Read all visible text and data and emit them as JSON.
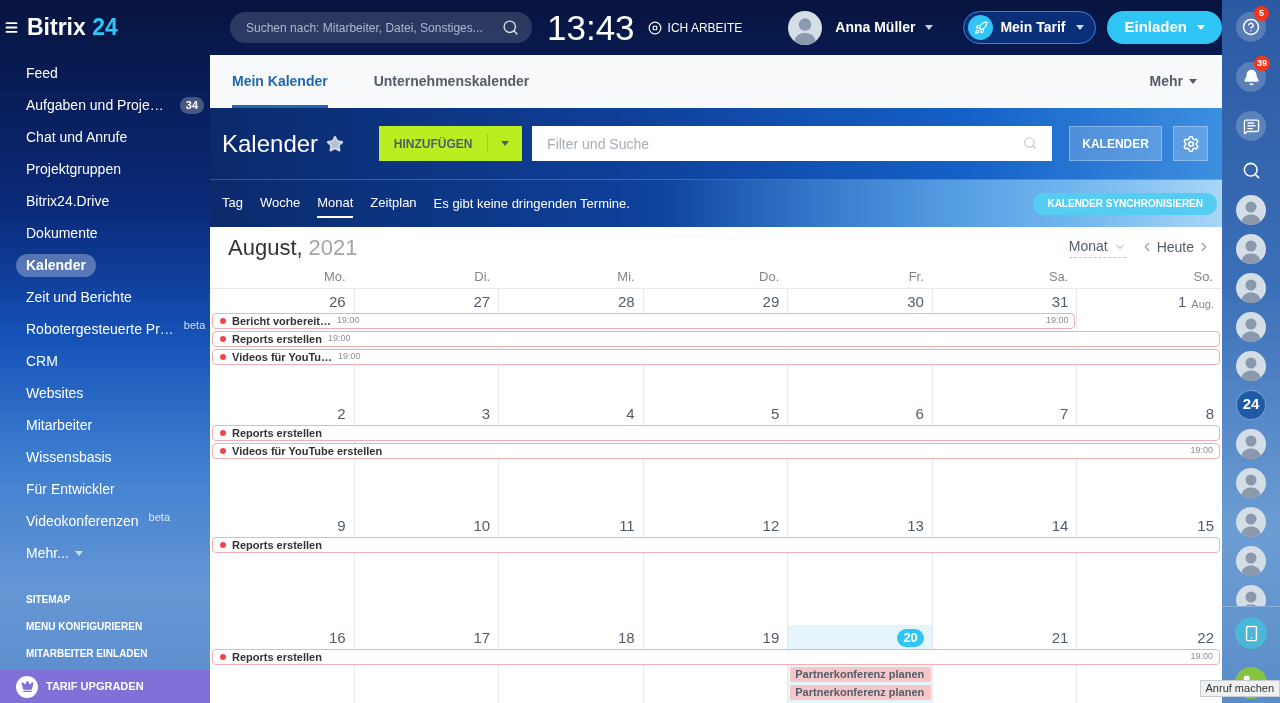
{
  "header": {
    "logo": {
      "text": "Bitrix",
      "accent": "24"
    },
    "search": {
      "placeholder": "Suchen nach: Mitarbeiter, Datei, Sonstiges..."
    },
    "clock": "13:43",
    "work_status": "ICH ARBEITE",
    "user_name": "Anna Müller",
    "tariff_button": "Mein Tarif",
    "invite_button": "Einladen"
  },
  "sidebar": {
    "items": [
      {
        "label": "Feed",
        "selected": false
      },
      {
        "label": "Aufgaben und Proje…",
        "selected": false,
        "counter": "34"
      },
      {
        "label": "Chat und Anrufe",
        "selected": false
      },
      {
        "label": "Projektgruppen",
        "selected": false
      },
      {
        "label": "Bitrix24.Drive",
        "selected": false
      },
      {
        "label": "Dokumente",
        "selected": false
      },
      {
        "label": "Kalender",
        "selected": true
      },
      {
        "label": "Zeit und Berichte",
        "selected": false
      },
      {
        "label": "Robotergesteuerte Pr…",
        "selected": false,
        "tag": "beta"
      },
      {
        "label": "CRM",
        "selected": false
      },
      {
        "label": "Websites",
        "selected": false
      },
      {
        "label": "Mitarbeiter",
        "selected": false
      },
      {
        "label": "Wissensbasis",
        "selected": false
      },
      {
        "label": "Für Entwickler",
        "selected": false
      },
      {
        "label": "Videokonferenzen",
        "selected": false,
        "tag": "beta"
      }
    ],
    "more": "Mehr...",
    "links": [
      "SITEMAP",
      "MENU KONFIGURIEREN",
      "MITARBEITER EINLADEN"
    ],
    "upgrade_button": "TARIF UPGRADEN"
  },
  "tabs": {
    "items": [
      {
        "label": "Mein Kalender",
        "selected": true
      },
      {
        "label": "Unternehmenskalender",
        "selected": false
      }
    ],
    "more": "Mehr"
  },
  "toolbar": {
    "title": "Kalender",
    "add_button": "HINZUFÜGEN",
    "filter": {
      "placeholder": "Filter und Suche"
    },
    "calendar_button": "KALENDER"
  },
  "views": {
    "items": [
      {
        "label": "Tag",
        "selected": false
      },
      {
        "label": "Woche",
        "selected": false
      },
      {
        "label": "Monat",
        "selected": true
      },
      {
        "label": "Zeitplan",
        "selected": false
      }
    ],
    "notice": "Es gibt keine dringenden Termine.",
    "sync_button": "KALENDER SYNCHRONISIEREN"
  },
  "calendar": {
    "month": "August,",
    "year": "2021",
    "view_select": "Monat",
    "today_button": "Heute",
    "weekdays": [
      "Mo.",
      "Di.",
      "Mi.",
      "Do.",
      "Fr.",
      "Sa.",
      "So."
    ],
    "weeks": [
      {
        "days": [
          {
            "number": "26",
            "today": false
          },
          {
            "number": "27",
            "today": false
          },
          {
            "number": "28",
            "today": false
          },
          {
            "number": "29",
            "today": false
          },
          {
            "number": "30",
            "today": false
          },
          {
            "number": "31",
            "today": false
          },
          {
            "number": "1",
            "month": "Aug.",
            "today": false
          }
        ],
        "lanes": [
          [
            {
              "kind": "start",
              "title": "Bericht vorbereit…",
              "time": "19:00"
            },
            {
              "kind": "middle"
            },
            {
              "kind": "middle"
            },
            {
              "kind": "middle"
            },
            {
              "kind": "middle"
            },
            {
              "kind": "end",
              "time": "19:00"
            },
            {
              "kind": "empty"
            }
          ],
          [
            {
              "kind": "start",
              "title": "Reports erstellen",
              "time": "19:00"
            },
            {
              "kind": "middle"
            },
            {
              "kind": "middle"
            },
            {
              "kind": "middle"
            },
            {
              "kind": "middle"
            },
            {
              "kind": "middle"
            },
            {
              "kind": "middle"
            }
          ],
          [
            {
              "kind": "start",
              "title": "Videos für YouTu…",
              "time": "19:00"
            },
            {
              "kind": "middle"
            },
            {
              "kind": "middle"
            },
            {
              "kind": "middle"
            },
            {
              "kind": "middle"
            },
            {
              "kind": "middle"
            },
            {
              "kind": "middle"
            }
          ]
        ]
      },
      {
        "days": [
          {
            "number": "2",
            "today": false
          },
          {
            "number": "3",
            "today": false
          },
          {
            "number": "4",
            "today": false
          },
          {
            "number": "5",
            "today": false
          },
          {
            "number": "6",
            "today": false
          },
          {
            "number": "7",
            "today": false
          },
          {
            "number": "8",
            "today": false
          }
        ],
        "lanes": [
          [
            {
              "kind": "start",
              "title": "Reports erstellen"
            },
            {
              "kind": "middle"
            },
            {
              "kind": "middle"
            },
            {
              "kind": "middle"
            },
            {
              "kind": "middle"
            },
            {
              "kind": "middle"
            },
            {
              "kind": "middle"
            }
          ],
          [
            {
              "kind": "start",
              "title": "Videos für YouTube erstellen"
            },
            {
              "kind": "middle"
            },
            {
              "kind": "middle"
            },
            {
              "kind": "middle"
            },
            {
              "kind": "middle"
            },
            {
              "kind": "middle"
            },
            {
              "kind": "end",
              "time": "19:00"
            }
          ]
        ]
      },
      {
        "days": [
          {
            "number": "9",
            "today": false
          },
          {
            "number": "10",
            "today": false
          },
          {
            "number": "11",
            "today": false
          },
          {
            "number": "12",
            "today": false
          },
          {
            "number": "13",
            "today": false
          },
          {
            "number": "14",
            "today": false
          },
          {
            "number": "15",
            "today": false
          }
        ],
        "lanes": [
          [
            {
              "kind": "start",
              "title": "Reports erstellen"
            },
            {
              "kind": "middle"
            },
            {
              "kind": "middle"
            },
            {
              "kind": "middle"
            },
            {
              "kind": "middle"
            },
            {
              "kind": "middle"
            },
            {
              "kind": "middle"
            }
          ]
        ]
      },
      {
        "days": [
          {
            "number": "16",
            "today": false
          },
          {
            "number": "17",
            "today": false
          },
          {
            "number": "18",
            "today": false
          },
          {
            "number": "19",
            "today": false
          },
          {
            "number": "20",
            "today": true
          },
          {
            "number": "21",
            "today": false
          },
          {
            "number": "22",
            "today": false
          }
        ],
        "lanes": [
          [
            {
              "kind": "start",
              "title": "Reports erstellen"
            },
            {
              "kind": "middle"
            },
            {
              "kind": "middle"
            },
            {
              "kind": "middle"
            },
            {
              "kind": "middle"
            },
            {
              "kind": "middle"
            },
            {
              "kind": "end",
              "time": "19:00"
            }
          ],
          [
            {
              "kind": "empty"
            },
            {
              "kind": "empty"
            },
            {
              "kind": "empty"
            },
            {
              "kind": "empty"
            },
            {
              "kind": "block",
              "title": "Partnerkonferenz planen"
            },
            {
              "kind": "empty"
            },
            {
              "kind": "empty"
            }
          ],
          [
            {
              "kind": "empty"
            },
            {
              "kind": "empty"
            },
            {
              "kind": "empty"
            },
            {
              "kind": "empty"
            },
            {
              "kind": "block",
              "title": "Partnerkonferenz planen"
            },
            {
              "kind": "empty"
            },
            {
              "kind": "empty"
            }
          ]
        ]
      }
    ]
  },
  "right_bar": {
    "items": [
      {
        "kind": "help",
        "badge": "5"
      },
      {
        "kind": "notifications",
        "badge": "39"
      },
      {
        "kind": "chat"
      },
      {
        "kind": "search"
      },
      {
        "kind": "avatar"
      },
      {
        "kind": "avatar"
      },
      {
        "kind": "avatar"
      },
      {
        "kind": "avatar"
      },
      {
        "kind": "avatar"
      },
      {
        "kind": "logo",
        "label": "24"
      },
      {
        "kind": "avatar"
      },
      {
        "kind": "avatar"
      },
      {
        "kind": "avatar"
      },
      {
        "kind": "avatar"
      },
      {
        "kind": "avatar"
      }
    ],
    "bottom": [
      {
        "kind": "mobile"
      },
      {
        "kind": "call"
      }
    ],
    "tooltip": "Anruf machen"
  }
}
